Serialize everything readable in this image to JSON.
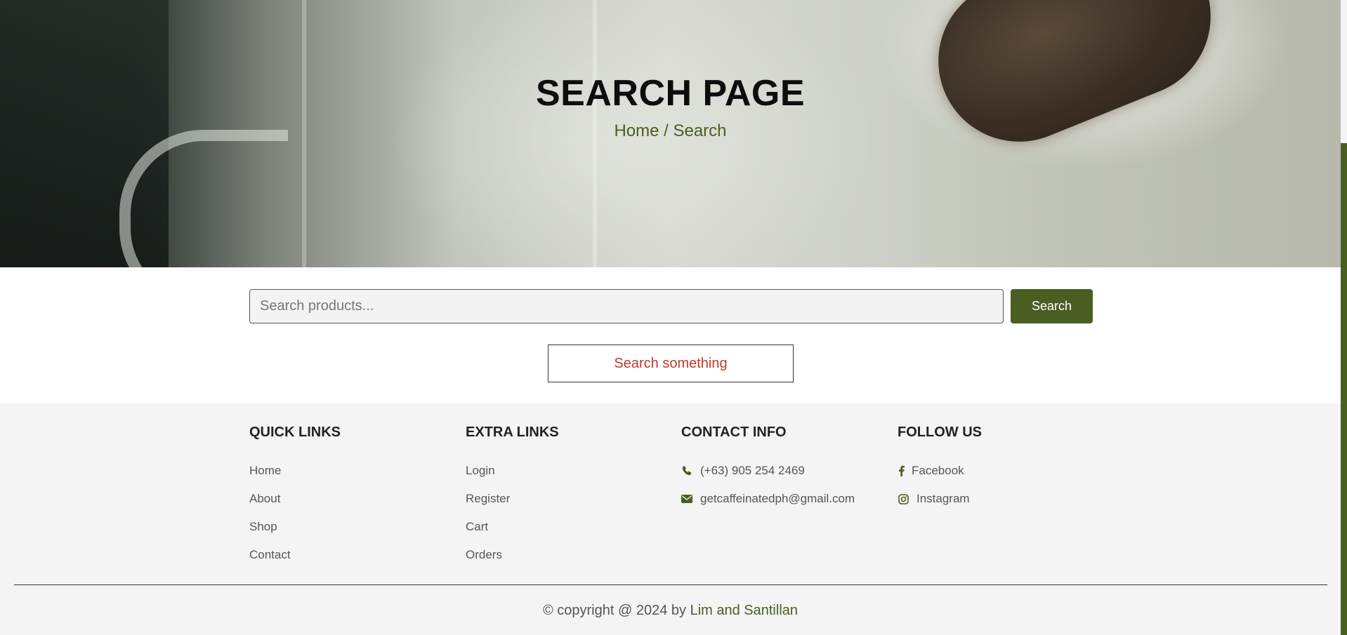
{
  "hero": {
    "title": "SEARCH PAGE",
    "breadcrumb": "Home / Search"
  },
  "search": {
    "placeholder": "Search products...",
    "value": "",
    "button_label": "Search",
    "empty_message": "Search something"
  },
  "footer": {
    "quick_links": {
      "heading": "QUICK LINKS",
      "items": [
        {
          "label": "Home"
        },
        {
          "label": "About"
        },
        {
          "label": "Shop"
        },
        {
          "label": "Contact"
        }
      ]
    },
    "extra_links": {
      "heading": "EXTRA LINKS",
      "items": [
        {
          "label": "Login"
        },
        {
          "label": "Register"
        },
        {
          "label": "Cart"
        },
        {
          "label": "Orders"
        }
      ]
    },
    "contact_info": {
      "heading": "CONTACT INFO",
      "items": [
        {
          "icon": "phone-icon",
          "label": "(+63) 905 254 2469"
        },
        {
          "icon": "envelope-icon",
          "label": "getcaffeinatedph@gmail.com"
        }
      ]
    },
    "follow_us": {
      "heading": "FOLLOW US",
      "items": [
        {
          "icon": "facebook-icon",
          "label": "Facebook"
        },
        {
          "icon": "instagram-icon",
          "label": "Instagram"
        }
      ]
    },
    "copyright": {
      "prefix": "© copyright @ 2024 by",
      "authors": "Lim and Santillan"
    }
  },
  "colors": {
    "accent": "#4b5e22",
    "empty_message": "#c0392b",
    "footer_background": "#f4f4f4"
  }
}
